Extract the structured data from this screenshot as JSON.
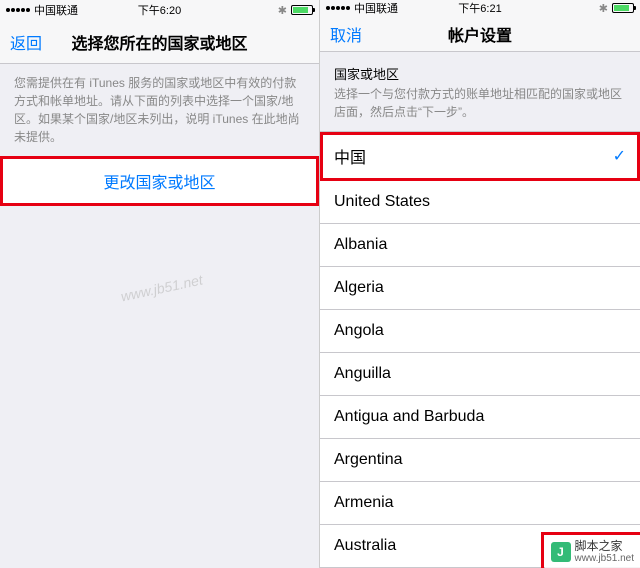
{
  "left": {
    "status": {
      "carrier": "中国联通",
      "time": "下午6:20",
      "bluetooth": "✱"
    },
    "nav": {
      "back": "返回",
      "title": "选择您所在的国家或地区"
    },
    "description": "您需提供在有 iTunes 服务的国家或地区中有效的付款方式和帐单地址。请从下面的列表中选择一个国家/地区。如果某个国家/地区未列出，说明 iTunes 在此地尚未提供。",
    "button": "更改国家或地区"
  },
  "right": {
    "status": {
      "carrier": "中国联通",
      "time": "下午6:21",
      "bluetooth": "✱"
    },
    "nav": {
      "back": "取消",
      "title": "帐户设置"
    },
    "section_label": "国家或地区",
    "section_desc": "选择一个与您付款方式的账单地址相匹配的国家或地区店面，然后点击“下一步”。",
    "selected": "中国",
    "countries": [
      "United States",
      "Albania",
      "Algeria",
      "Angola",
      "Anguilla",
      "Antigua and Barbuda",
      "Argentina",
      "Armenia",
      "Australia"
    ]
  },
  "watermark": "www.jb51.net",
  "footer": {
    "brand": "脚本之家",
    "url": "www.jb51.net",
    "logo": "J"
  }
}
